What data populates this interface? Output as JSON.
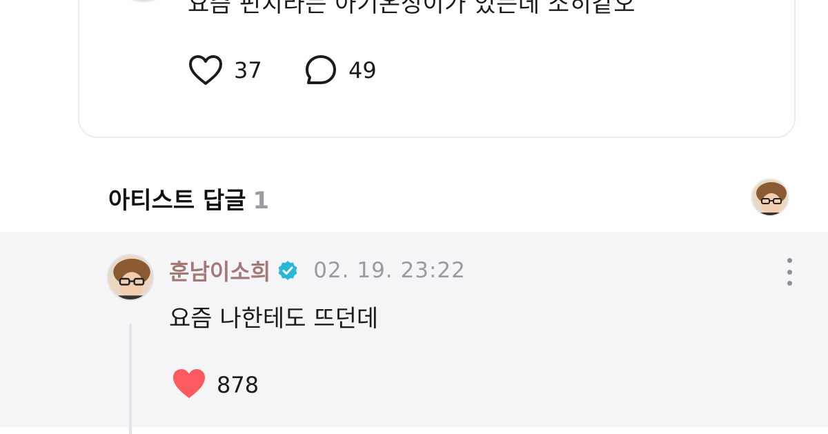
{
  "post": {
    "text": "요즘 펀치라는 아기온싱이가 있는데 소히같오",
    "likes": "37",
    "comments": "49"
  },
  "artist_replies": {
    "title": "아티스트 답글",
    "count": "1"
  },
  "reply": {
    "author": "훈남이소희",
    "timestamp": "02. 19. 23:22",
    "text": "요즘 나한테도 뜨던데",
    "likes": "878"
  },
  "icons": {
    "like": "heart-outline-icon",
    "comment": "speech-bubble-icon",
    "verified": "verified-badge-icon",
    "liked": "heart-filled-icon",
    "menu": "kebab-menu-icon"
  },
  "colors": {
    "author_name": "#a37975",
    "verified_badge": "#28b7d6",
    "liked_heart": "#ff5a5f",
    "reply_background": "#f5f5f8"
  }
}
